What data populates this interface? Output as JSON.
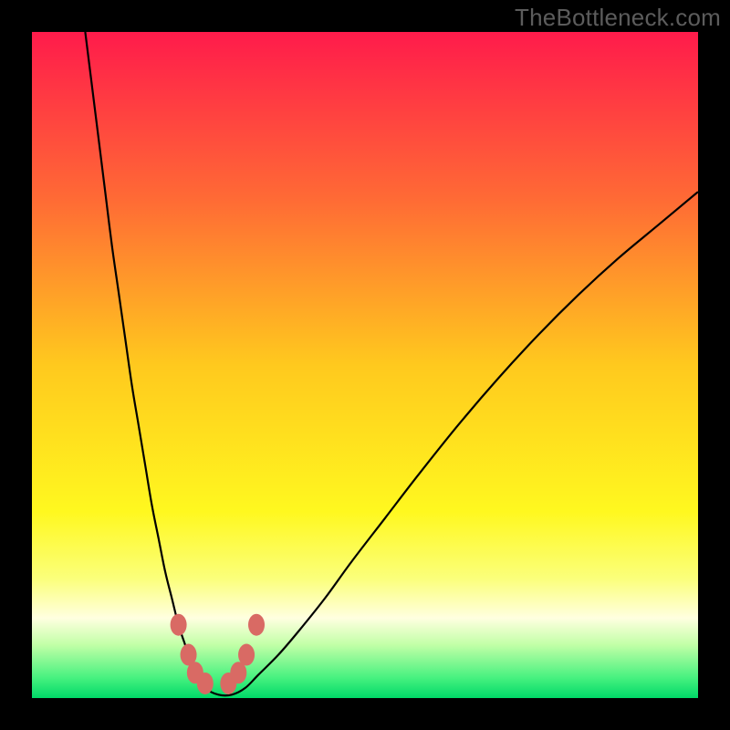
{
  "watermark": "TheBottleneck.com",
  "chart_data": {
    "type": "line",
    "title": "",
    "xlabel": "",
    "ylabel": "",
    "xlim": [
      0,
      100
    ],
    "ylim": [
      0,
      100
    ],
    "grid": false,
    "legend": false,
    "background_gradient": {
      "stops": [
        {
          "offset": 0.0,
          "color": "#ff1b4b"
        },
        {
          "offset": 0.25,
          "color": "#ff6a35"
        },
        {
          "offset": 0.5,
          "color": "#ffc91e"
        },
        {
          "offset": 0.72,
          "color": "#fff81f"
        },
        {
          "offset": 0.82,
          "color": "#fbff7a"
        },
        {
          "offset": 0.88,
          "color": "#ffffe0"
        },
        {
          "offset": 0.92,
          "color": "#c2ffa7"
        },
        {
          "offset": 0.97,
          "color": "#46f17f"
        },
        {
          "offset": 1.0,
          "color": "#00d968"
        }
      ]
    },
    "curve": {
      "x": [
        8,
        9,
        10,
        11,
        12,
        13,
        14,
        15,
        16,
        17,
        18,
        19,
        20,
        21,
        22,
        23,
        24,
        25,
        26,
        28,
        30,
        32,
        34,
        37,
        40,
        44,
        48,
        53,
        58,
        64,
        70,
        76,
        82,
        88,
        94,
        100
      ],
      "y": [
        100,
        92,
        84,
        76,
        68,
        61,
        54,
        47,
        41,
        35,
        29,
        24,
        19,
        15,
        11,
        8,
        5,
        3,
        1.5,
        0.5,
        0.5,
        1.5,
        3.5,
        6.5,
        10,
        15,
        20.5,
        27,
        33.5,
        41,
        48,
        54.5,
        60.5,
        66,
        71,
        76
      ]
    },
    "markers": [
      {
        "x": 22.0,
        "y": 11.0
      },
      {
        "x": 23.5,
        "y": 6.5
      },
      {
        "x": 24.5,
        "y": 3.8
      },
      {
        "x": 26.0,
        "y": 2.2
      },
      {
        "x": 29.5,
        "y": 2.2
      },
      {
        "x": 31.0,
        "y": 3.8
      },
      {
        "x": 32.2,
        "y": 6.5
      },
      {
        "x": 33.7,
        "y": 11.0
      }
    ],
    "marker_color": "#d96a64"
  }
}
